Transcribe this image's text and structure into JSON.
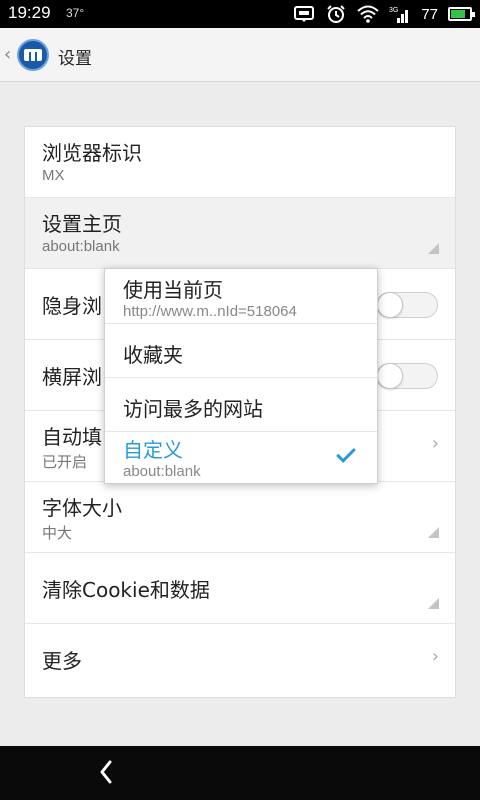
{
  "status_bar": {
    "time": "19:29",
    "temperature": "37°",
    "battery_level": "77",
    "battery_fraction": 0.77,
    "battery_color": "#35c24a"
  },
  "titlebar": {
    "title": "设置"
  },
  "settings": [
    {
      "title": "浏览器标识",
      "subtitle": "MX",
      "accessory": "none"
    },
    {
      "title": "设置主页",
      "subtitle": "about:blank",
      "accessory": "dropdown-corner-icon"
    },
    {
      "title": "隐身浏",
      "subtitle": "",
      "accessory": "toggle"
    },
    {
      "title": "横屏浏",
      "subtitle": "",
      "accessory": "toggle"
    },
    {
      "title": "自动填",
      "subtitle": "已开启",
      "accessory": "chevron-right-icon"
    },
    {
      "title": "字体大小",
      "subtitle": "中大",
      "accessory": "dropdown-corner-icon"
    },
    {
      "title": "清除Cookie和数据",
      "subtitle": "",
      "accessory": "dropdown-corner-icon"
    },
    {
      "title": "更多",
      "subtitle": "",
      "accessory": "chevron-right-icon"
    }
  ],
  "popup": {
    "items": [
      {
        "title": "使用当前页",
        "subtitle": "http://www.m..nId=518064",
        "selected": false
      },
      {
        "title": "收藏夹",
        "subtitle": "",
        "selected": false
      },
      {
        "title": "访问最多的网站",
        "subtitle": "",
        "selected": false
      },
      {
        "title": "自定义",
        "subtitle": "about:blank",
        "selected": true
      }
    ]
  },
  "colors": {
    "accent": "#2a9bd8",
    "background": "#ececec",
    "logo": "#1b5aa8"
  }
}
